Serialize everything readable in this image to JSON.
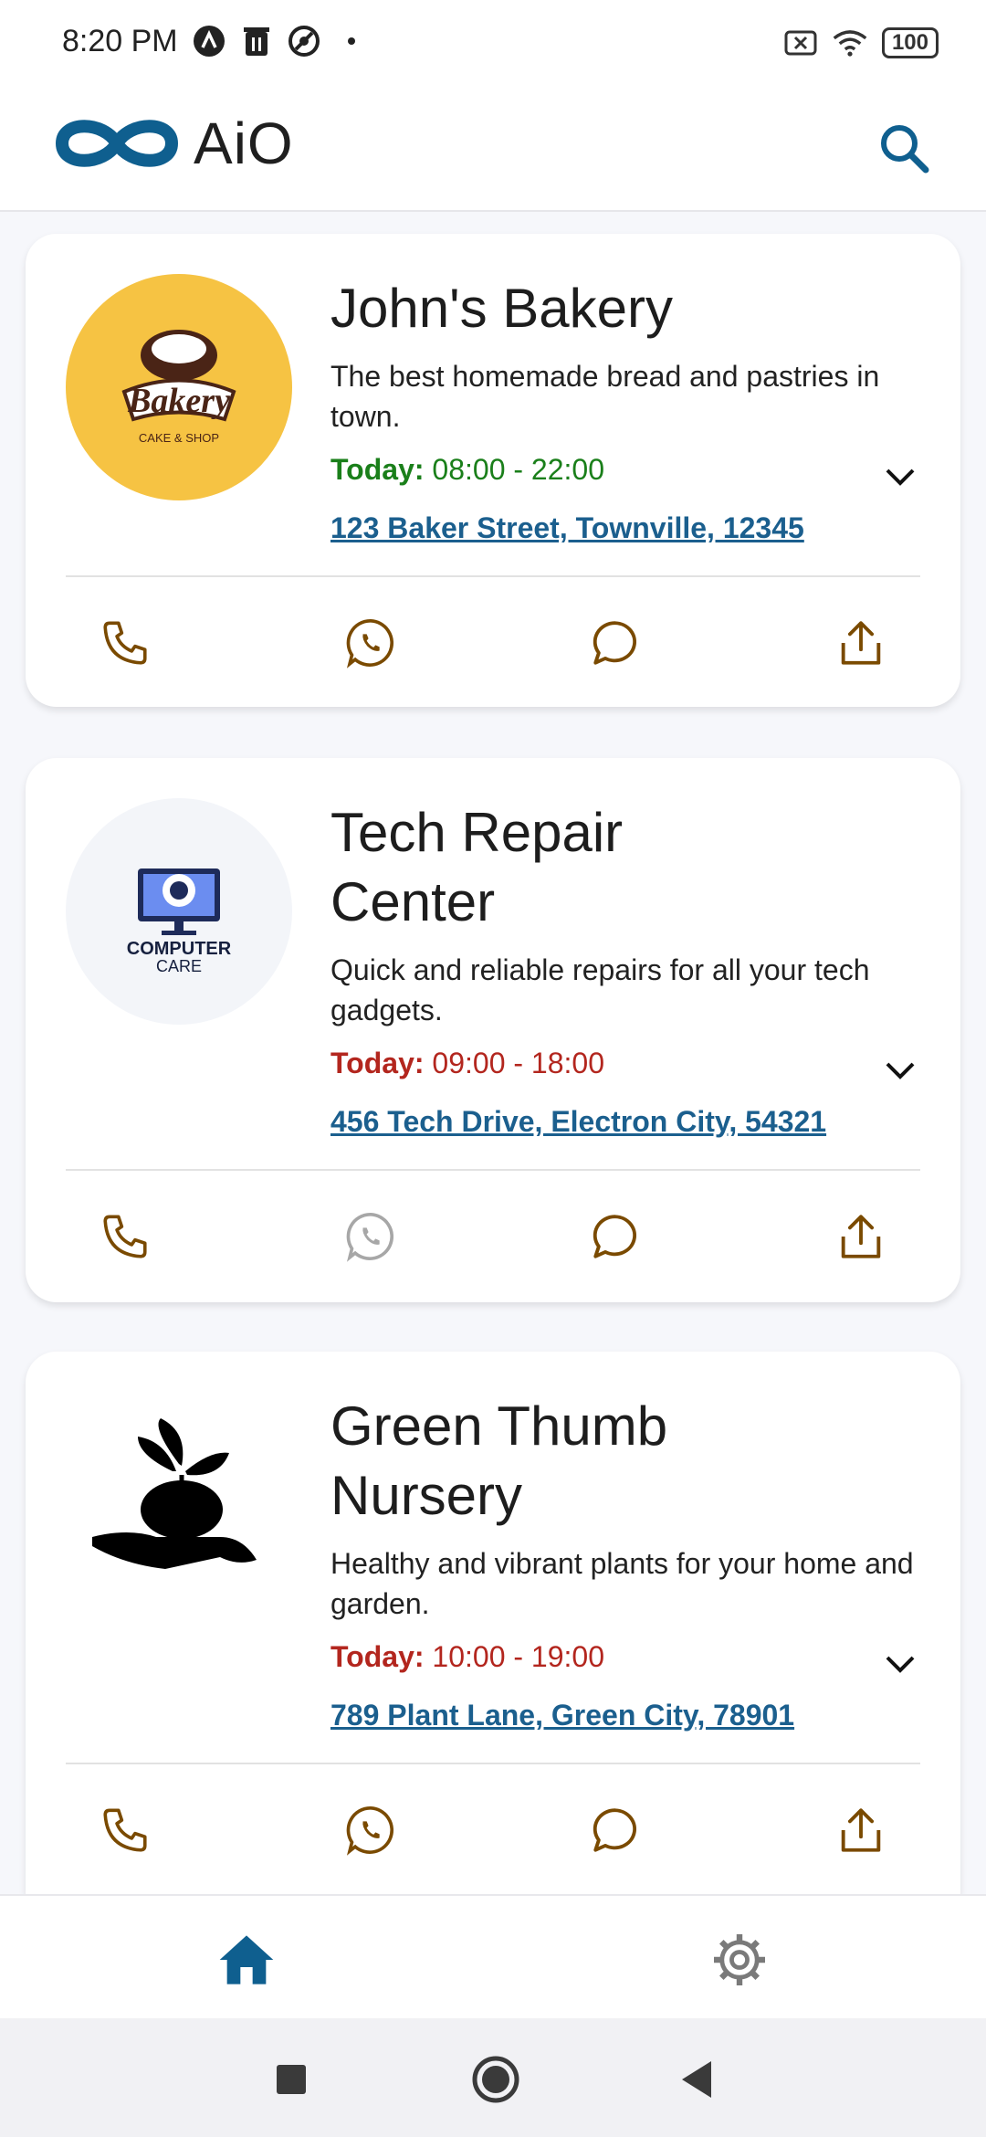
{
  "status": {
    "time": "8:20 PM",
    "battery": "100"
  },
  "appbar": {
    "app_name": "AiO",
    "icons": [
      "infinity-logo-icon",
      "search-icon"
    ]
  },
  "businesses": [
    {
      "name": "John's Bakery",
      "description": "The best homemade bread and pastries in town.",
      "today_label": "Today:",
      "hours": "08:00 - 22:00",
      "open_status_color": "#1a7f1a",
      "address": "123 Baker Street, Townville, 12345",
      "logo": {
        "title": "Bakery",
        "subtitle": "CAKE & SHOP",
        "bg": "#f6c343"
      },
      "whatsapp_enabled": true
    },
    {
      "name": "Tech Repair Center",
      "description": "Quick and reliable repairs for all your tech gadgets.",
      "today_label": "Today:",
      "hours": "09:00 - 18:00",
      "open_status_color": "#b3261e",
      "address": "456 Tech Drive, Electron City, 54321",
      "logo": {
        "title": "COMPUTER",
        "subtitle": "CARE",
        "bg": "#f3f5f9"
      },
      "whatsapp_enabled": false
    },
    {
      "name": "Green Thumb Nursery",
      "description": "Healthy and vibrant plants for your home and garden.",
      "today_label": "Today:",
      "hours": "10:00 - 19:00",
      "open_status_color": "#b3261e",
      "address": "789 Plant Lane, Green City, 78901",
      "logo": {
        "bg": "#ffffff"
      },
      "whatsapp_enabled": true
    }
  ],
  "bottom_nav": [
    "home-icon",
    "settings-icon"
  ],
  "colors": {
    "accent": "#0f5f8f",
    "action_icon": "#7a4a00",
    "disabled_icon": "#a7a7a7"
  }
}
